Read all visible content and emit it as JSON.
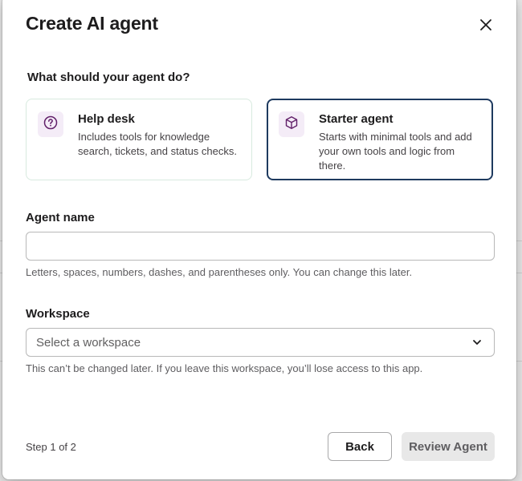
{
  "modal": {
    "title": "Create AI agent"
  },
  "question": "What should your agent do?",
  "cards": [
    {
      "title": "Help desk",
      "description": "Includes tools for knowledge search, tickets, and status checks.",
      "icon": "question-circle-icon",
      "selected": false
    },
    {
      "title": "Starter agent",
      "description": "Starts with minimal tools and add your own tools and logic from there.",
      "icon": "cube-icon",
      "selected": true
    }
  ],
  "agent_name": {
    "label": "Agent name",
    "value": "",
    "placeholder": "",
    "hint": "Letters, spaces, numbers, dashes, and parentheses only. You can change this later."
  },
  "workspace": {
    "label": "Workspace",
    "placeholder": "Select a workspace",
    "hint": "This can’t be changed later. If you leave this workspace, you’ll lose access to this app."
  },
  "footer": {
    "step": "Step 1 of 2",
    "back_label": "Back",
    "review_label": "Review Agent"
  },
  "colors": {
    "selected_border": "#1e3a5f",
    "icon_bg": "#f4ecf7",
    "icon_stroke": "#611f69",
    "disabled_button_bg": "#e8e8e8"
  }
}
